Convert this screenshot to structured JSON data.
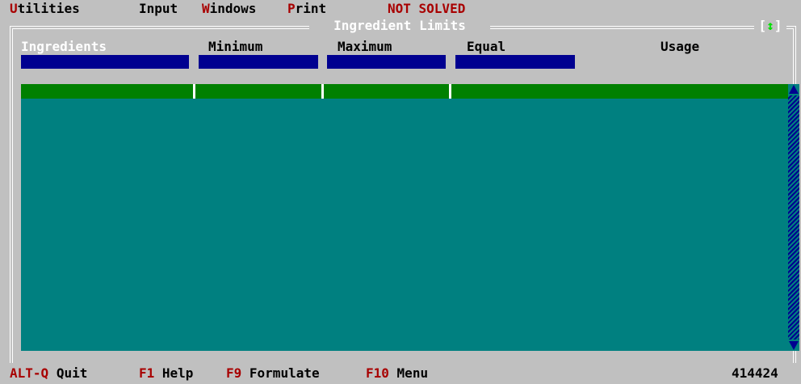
{
  "menu": {
    "utilities": {
      "hot": "U",
      "rest": "tilities"
    },
    "input": {
      "text": "Input"
    },
    "windows": {
      "hot": "W",
      "rest": "indows"
    },
    "print": {
      "hot": "P",
      "rest": "rint"
    }
  },
  "status": "NOT SOLVED",
  "window": {
    "title": "Ingredient Limits",
    "resize_left": "[",
    "resize_arrow": "↕",
    "resize_right": "]"
  },
  "columns": {
    "ingredients": "Ingredients",
    "minimum": "Minimum",
    "maximum": "Maximum",
    "equal": "Equal",
    "usage": "Usage"
  },
  "fields": {
    "ingredients": "",
    "minimum": "",
    "maximum": "",
    "equal": ""
  },
  "bottom": {
    "quit": {
      "key": "ALT-Q",
      "label": "Quit"
    },
    "help": {
      "key": "F1",
      "label": "Help"
    },
    "formulate": {
      "key": "F9",
      "label": "Formulate"
    },
    "menu": {
      "key": "F10",
      "label": "Menu"
    },
    "counter": "414424"
  },
  "icons": {
    "scroll_up": "up-arrow-icon",
    "scroll_down": "down-arrow-icon",
    "resize": "updown-arrow-icon"
  },
  "colors": {
    "background": "#c0c0c0",
    "field": "#000090",
    "grid_header": "#008000",
    "grid_body": "#008080",
    "hotkey": "#a80000"
  }
}
